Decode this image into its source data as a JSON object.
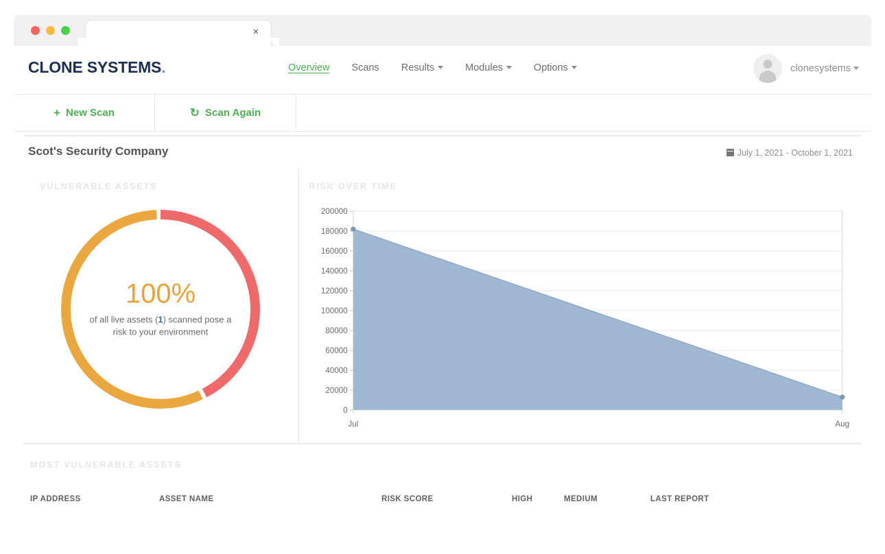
{
  "browser": {
    "tab_close_label": "×"
  },
  "navbar": {
    "brand_main": "CLONE SYSTEMS",
    "brand_dot": ".",
    "links": [
      {
        "label": "Overview",
        "active": true,
        "has_caret": false
      },
      {
        "label": "Scans",
        "active": false,
        "has_caret": false
      },
      {
        "label": "Results",
        "active": false,
        "has_caret": true
      },
      {
        "label": "Modules",
        "active": false,
        "has_caret": true
      },
      {
        "label": "Options",
        "active": false,
        "has_caret": true
      }
    ],
    "user_name": "clonesystems"
  },
  "actionbar": {
    "new_scan_glyph": "+",
    "new_scan_label": "New Scan",
    "scan_again_glyph": "↻",
    "scan_again_label": "Scan Again"
  },
  "page_header": {
    "title": "Scot's Security Company",
    "date_range": "July 1, 2021 - October 1, 2021"
  },
  "vulnerable_assets": {
    "panel_label": "VULNERABLE ASSETS",
    "percent": "100%",
    "description_before": "of all live assets (",
    "count": "1",
    "description_after": ") scanned pose a risk to your environment",
    "colors": {
      "high": "#ef6b6b",
      "medium": "#eba73f",
      "percent_text": "#e8a33d",
      "count_text": "#2f6fb5"
    },
    "segments": [
      {
        "name": "high",
        "fraction": 0.43,
        "color": "#ef6b6b"
      },
      {
        "name": "medium",
        "fraction": 0.57,
        "color": "#eba73f"
      }
    ]
  },
  "risk_over_time": {
    "panel_label": "RISK OVER TIME"
  },
  "chart_data": {
    "type": "area",
    "title": "RISK OVER TIME",
    "xlabel": "",
    "ylabel": "",
    "x": [
      "Jul",
      "Aug"
    ],
    "series": [
      {
        "name": "Risk",
        "values": [
          182000,
          13000
        ]
      }
    ],
    "ylim": [
      0,
      200000
    ],
    "yticks": [
      0,
      20000,
      40000,
      60000,
      80000,
      100000,
      120000,
      140000,
      160000,
      180000,
      200000
    ],
    "ytick_labels": [
      "0",
      "20000",
      "40000",
      "60000",
      "80000",
      "100000",
      "120000",
      "140000",
      "160000",
      "180000",
      "200000"
    ],
    "xtick_labels": [
      "Jul",
      "Aug"
    ],
    "grid": true,
    "legend": false,
    "area_color": "#9cb4d0",
    "line_color": "#8fa8c6",
    "marker_color": "#7f96b5"
  },
  "most_vulnerable_assets": {
    "section_label": "MOST VULNERABLE ASSETS",
    "columns": [
      "IP ADDRESS",
      "ASSET NAME",
      "RISK SCORE",
      "HIGH",
      "MEDIUM",
      "LAST REPORT"
    ],
    "rows": []
  }
}
